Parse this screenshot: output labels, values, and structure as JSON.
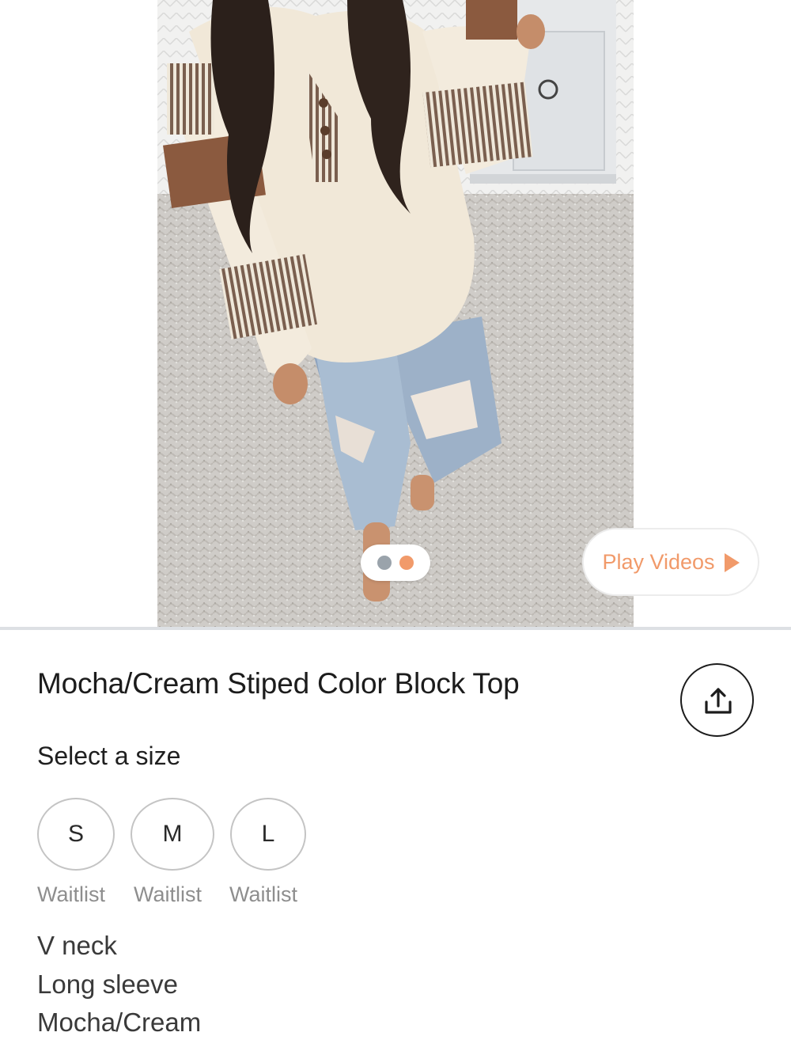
{
  "gallery": {
    "indicator_colors": {
      "inactive": "#9aa3ab",
      "active": "#f19a6a"
    },
    "play_button": {
      "label": "Play Videos",
      "accent": "#f19a6a",
      "icon": "play-icon"
    }
  },
  "product": {
    "title": "Mocha/Cream Stiped Color Block Top",
    "share_icon": "share-icon"
  },
  "sizes": {
    "label": "Select a size",
    "options": [
      {
        "label": "S",
        "status": "Waitlist"
      },
      {
        "label": "M",
        "status": "Waitlist"
      },
      {
        "label": "L",
        "status": "Waitlist"
      }
    ]
  },
  "description": {
    "features": [
      "V neck",
      "Long sleeve",
      "Mocha/Cream"
    ]
  }
}
